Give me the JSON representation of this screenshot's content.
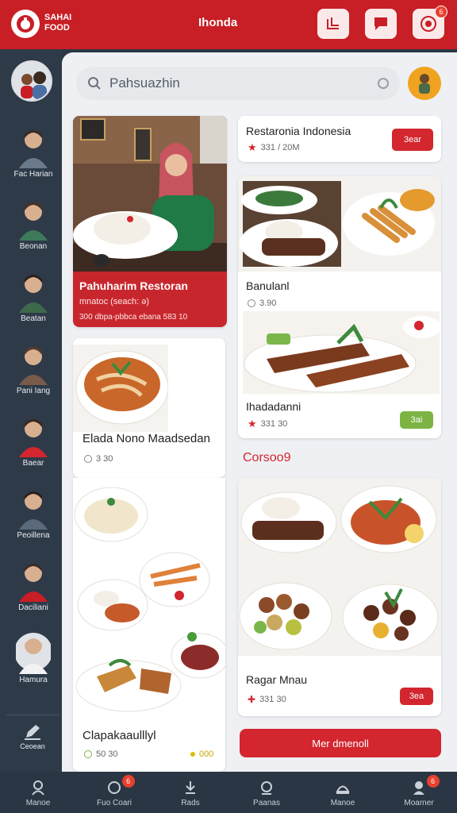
{
  "header": {
    "logo_text": "SAHAI FOOD",
    "title": "Ihonda",
    "badge_count": "6"
  },
  "sidebar": {
    "items": [
      {
        "label": "Fac Harian"
      },
      {
        "label": "Beonan"
      },
      {
        "label": "Beatan"
      },
      {
        "label": "Pani Iang"
      },
      {
        "label": "Baear"
      },
      {
        "label": "Peoillena"
      },
      {
        "label": "Daciliani"
      },
      {
        "label": "Hamura"
      }
    ],
    "bottom_label": "Ceoean"
  },
  "search": {
    "value": "Pahsuazhin"
  },
  "cards": {
    "featured": {
      "title": "Pahuharim Restoran",
      "subtitle": "mnatoc (seach: ə)",
      "meta": "300 dbpa-pbbca ebana 583 10"
    },
    "restaurant": {
      "title": "Restaronia Indonesia",
      "rating": "331 / 20M",
      "button": "3ear"
    },
    "banulani": {
      "title": "Banulanl",
      "rating": "3.90"
    },
    "hadani": {
      "title": "Ihadadanni",
      "rating": "331 30",
      "button": "3ai"
    },
    "elada": {
      "title": "Elada Nono Maadsedan",
      "rating": "3 30"
    },
    "clapa": {
      "title": "Clapakaaulllyl",
      "rating": "50 30",
      "extra": "000"
    },
    "ragar": {
      "title": "Ragar Mnau",
      "rating": "331 30",
      "button": "3ea"
    }
  },
  "section_title": "Corsoo9",
  "cta_label": "Mer dmenoll",
  "bottom_nav": {
    "items": [
      {
        "label": "Manoe"
      },
      {
        "label": "Fuo Coari",
        "badge": "6"
      },
      {
        "label": "Rads"
      },
      {
        "label": "Paanas"
      },
      {
        "label": "Manoe"
      },
      {
        "label": "Moarner",
        "badge": "6"
      }
    ]
  },
  "colors": {
    "brand_red": "#c81e25",
    "sidebar": "#2e3a48",
    "accent_green": "#7cb342",
    "avatar_orange": "#f0a320"
  }
}
